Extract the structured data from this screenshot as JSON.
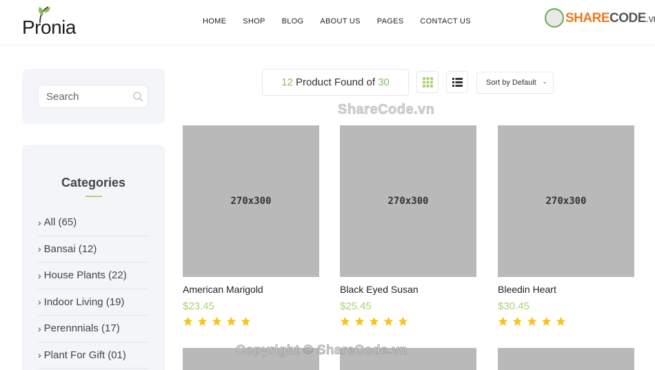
{
  "header": {
    "logo_text": "Pronia",
    "nav": [
      "HOME",
      "SHOP",
      "BLOG",
      "ABOUT US",
      "PAGES",
      "CONTACT US"
    ],
    "brand": {
      "part1": "SHARE",
      "part2": "CODE",
      "part3": ".vn"
    }
  },
  "sidebar": {
    "search_placeholder": "Search",
    "categories_title": "Categories",
    "categories": [
      {
        "label": "All (65)"
      },
      {
        "label": "Bansai (12)"
      },
      {
        "label": "House Plants (22)"
      },
      {
        "label": "Indoor Living (19)"
      },
      {
        "label": "Perennnials (17)"
      },
      {
        "label": "Plant For Gift (01)"
      }
    ]
  },
  "toolbar": {
    "found_count": "12",
    "found_text": " Product Found of ",
    "total_count": "30",
    "sort_label": "Sort by Default"
  },
  "products": [
    {
      "image_text": "270x300",
      "name": "American Marigold",
      "price": "$23.45",
      "rating": 5
    },
    {
      "image_text": "270x300",
      "name": "Black Eyed Susan",
      "price": "$25.45",
      "rating": 5
    },
    {
      "image_text": "270x300",
      "name": "Bleedin Heart",
      "price": "$30.45",
      "rating": 5
    }
  ],
  "watermarks": {
    "top": "ShareCode.vn",
    "bottom": "Copyright © ShareCode.vn"
  },
  "colors": {
    "accent": "#abd373",
    "star": "#f5c518",
    "placeholder": "#b9b9b9"
  }
}
